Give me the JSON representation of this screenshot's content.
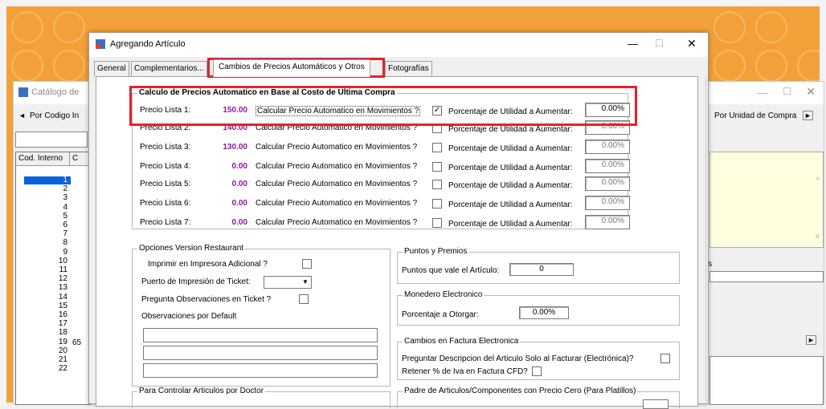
{
  "colors": {
    "accent_red": "#e0242a",
    "value_purple": "#8b1a9a",
    "orange_bg": "#f2a13a",
    "selection_blue": "#0a64d6"
  },
  "back_window": {
    "title": "Catálogo de",
    "by_code_label": "Por Codigo In",
    "by_unit_label": "Por Unidad de Compra",
    "col_internal": "Cod. Interno",
    "col_c": "C",
    "row_numbers": [
      "1",
      "2",
      "3",
      "4",
      "5",
      "6",
      "7",
      "8",
      "9",
      "10",
      "11",
      "12",
      "13",
      "14",
      "15",
      "16",
      "17",
      "18",
      "19",
      "20",
      "21",
      "22"
    ],
    "row_16_extra": "65"
  },
  "dialog": {
    "title": "Agregando Artículo",
    "minimize": "—",
    "maximize": "☐",
    "close": "✕",
    "tabs": [
      {
        "label": "General"
      },
      {
        "label": "Complementarios..."
      },
      {
        "label": "Cambios de Precios Automáticos y Otros"
      },
      {
        "label": "Fotografías"
      }
    ],
    "price_group": {
      "title": "Calculo de Precios Automatico en Base al Costo de Ultima Compra",
      "calc_label": "Calcular Precio Automatico en Movimientos ?",
      "pct_label": "Porcentaje de Utilidad a Aumentar:",
      "rows": [
        {
          "name": "Precio Lista 1:",
          "value": "150.00",
          "checked": true,
          "pct": "0.00%"
        },
        {
          "name": "Precio Lista 2:",
          "value": "140.00",
          "checked": false,
          "pct": "0.00%"
        },
        {
          "name": "Precio Lista 3:",
          "value": "130.00",
          "checked": false,
          "pct": "0.00%"
        },
        {
          "name": "Precio Lista 4:",
          "value": "0.00",
          "checked": false,
          "pct": "0.00%"
        },
        {
          "name": "Precio Lista 5:",
          "value": "0.00",
          "checked": false,
          "pct": "0.00%"
        },
        {
          "name": "Precio Lista 6:",
          "value": "0.00",
          "checked": false,
          "pct": "0.00%"
        },
        {
          "name": "Precio Lista 7:",
          "value": "0.00",
          "checked": false,
          "pct": "0.00%"
        }
      ]
    },
    "restaurant": {
      "title": "Opciones Version Restaurant",
      "print_additional": "Imprimir en Impresora  Adicional ?",
      "ticket_port": "Puerto de Impresión de Ticket:",
      "ask_observations": "Pregunta Observaciones en Ticket ?",
      "default_observations": "Observaciones por Default"
    },
    "points": {
      "title": "Puntos y Premios",
      "label": "Puntos que vale el Artículo:",
      "value": "0"
    },
    "wallet": {
      "title": "Monedero Electronico",
      "label": "Porcentaje a Otorgar:",
      "value": "0.00%"
    },
    "invoice": {
      "title": "Cambios en Factura Electronica",
      "ask_description": "Preguntar Descripcion del Articulo Solo al Facturar (Electrónica)?",
      "retain_iva": "Retener % de Iva en Factura CFD?"
    },
    "doctor": {
      "title": "Para Controlar Articulos por Doctor"
    },
    "parent": {
      "title": "Padre de Articulos/Componentes con Precio Cero (Para Platillos)"
    }
  }
}
